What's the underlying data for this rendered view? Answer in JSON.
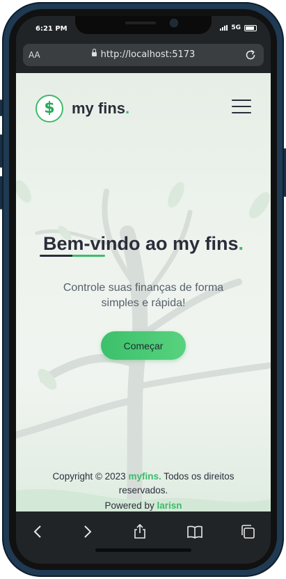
{
  "status_bar": {
    "time": "6:21 PM",
    "network": "5G"
  },
  "browser": {
    "text_size_label": "AA",
    "url": "http://localhost:5173"
  },
  "header": {
    "logo_symbol": "$",
    "logo_text": "my fins",
    "logo_dot": "."
  },
  "hero": {
    "title": "Bem-vindo ao my fins",
    "title_dot": ".",
    "subtitle": "Controle suas finanças de forma simples e rápida!",
    "cta_label": "Começar"
  },
  "footer": {
    "copyright_prefix": "Copyright © 2023",
    "brand": "myfins.",
    "copyright_suffix": "Todos os direitos reservados.",
    "powered_prefix": "Powered by",
    "powered_brand": "larisn"
  },
  "colors": {
    "accent": "#3dbb6a",
    "text": "#2b2d3a",
    "chrome": "#212426"
  },
  "toolbar": {
    "icons": [
      "back-icon",
      "forward-icon",
      "share-icon",
      "bookmarks-icon",
      "tabs-icon"
    ]
  }
}
